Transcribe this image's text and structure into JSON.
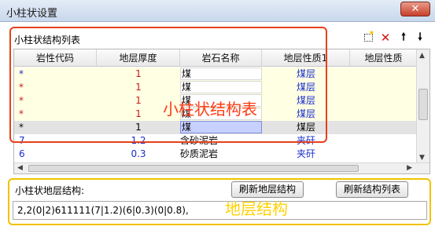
{
  "window": {
    "title": "小柱状设置",
    "close_label": "✕"
  },
  "top_group": {
    "title": "小柱状结构列表",
    "toolbar": {
      "new_icon": "new-item-icon",
      "delete_icon": "delete-icon",
      "delete_glyph": "✕",
      "up_glyph": "🠕",
      "down_glyph": "🠗"
    }
  },
  "grid": {
    "columns": [
      "岩性代码",
      "地层厚度",
      "岩石名称",
      "地层性质1",
      "地层性质"
    ],
    "rows": [
      {
        "code": "*",
        "thickness": "1",
        "name": "煤",
        "nature": "煤层"
      },
      {
        "code": "*",
        "thickness": "1",
        "name": "煤",
        "nature": "煤层"
      },
      {
        "code": "*",
        "thickness": "1",
        "name": "煤",
        "nature": "煤层"
      },
      {
        "code": "*",
        "thickness": "1",
        "name": "煤",
        "nature": "煤层"
      },
      {
        "code": "*",
        "thickness": "1",
        "name": "煤",
        "nature": "煤层"
      },
      {
        "code": "7",
        "thickness": "1.2",
        "name": "含砂泥岩",
        "nature": "夹矸"
      },
      {
        "code": "6",
        "thickness": "0.3",
        "name": "砂质泥岩",
        "nature": "夹矸"
      }
    ]
  },
  "annotations": {
    "red_label": "小柱状结构表",
    "yellow_label": "地层结构"
  },
  "bottom": {
    "label": "小柱状地层结构:",
    "refresh_layer_button": "刷新地层结构",
    "refresh_list_button": "刷新结构列表",
    "structure_value": "2,2(0|2)611111(7|1.2)(6|0.3)(0|0.8),"
  },
  "colors": {
    "red_text": "#cc1a1a",
    "blue_text": "#1a2ecc",
    "anno_red": "#e8401a",
    "anno_yellow": "#f2c200"
  }
}
